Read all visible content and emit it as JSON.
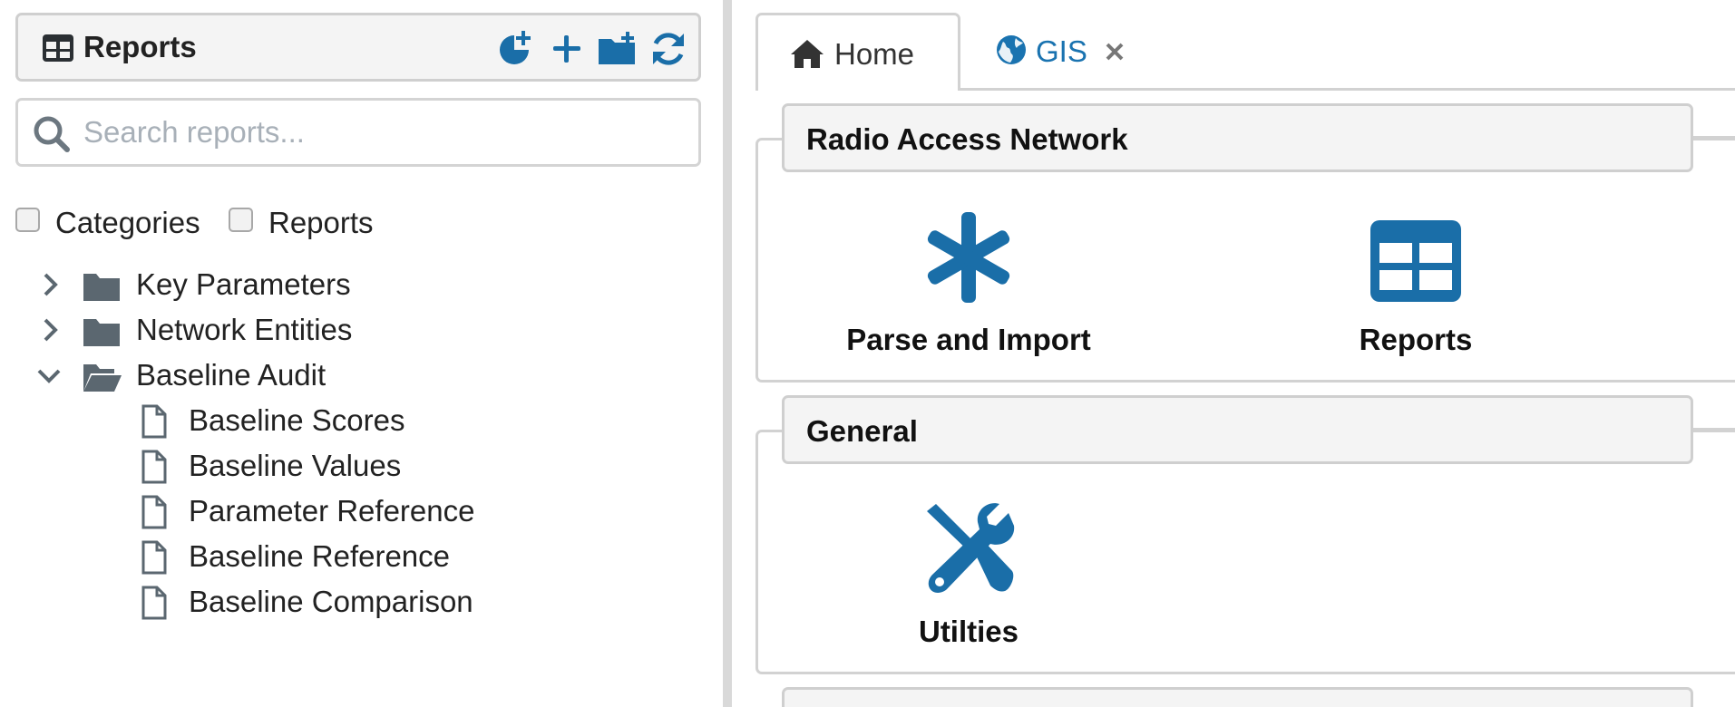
{
  "sidebar": {
    "title": "Reports",
    "toolbar": {
      "icons": [
        "add-schedule-icon",
        "plus-icon",
        "folder-plus-icon",
        "refresh-icon"
      ]
    },
    "search": {
      "placeholder": "Search reports...",
      "value": ""
    },
    "filters": [
      {
        "label": "Categories",
        "checked": false
      },
      {
        "label": "Reports",
        "checked": false
      }
    ],
    "tree": [
      {
        "label": "Key Parameters",
        "type": "folder",
        "expanded": false
      },
      {
        "label": "Network Entities",
        "type": "folder",
        "expanded": false
      },
      {
        "label": "Baseline Audit",
        "type": "folder",
        "expanded": true,
        "children": [
          {
            "label": "Baseline Scores"
          },
          {
            "label": "Baseline Values"
          },
          {
            "label": "Parameter Reference"
          },
          {
            "label": "Baseline Reference"
          },
          {
            "label": "Baseline Comparison"
          }
        ]
      }
    ]
  },
  "tabs": [
    {
      "label": "Home",
      "icon": "home-icon",
      "active": true,
      "closable": false
    },
    {
      "label": "GIS",
      "icon": "globe-icon",
      "active": false,
      "closable": true
    }
  ],
  "sections": [
    {
      "title": "Radio Access Network",
      "tiles": [
        {
          "label": "Parse and Import",
          "icon": "asterisk-icon"
        },
        {
          "label": "Reports",
          "icon": "table-icon"
        }
      ]
    },
    {
      "title": "General",
      "tiles": [
        {
          "label": "Utilties",
          "icon": "tools-icon"
        }
      ]
    }
  ],
  "colors": {
    "accent": "#1a6ea8",
    "icon_gray": "#5b6770",
    "header_bg": "#f4f4f4",
    "border": "#d2d2d2"
  }
}
